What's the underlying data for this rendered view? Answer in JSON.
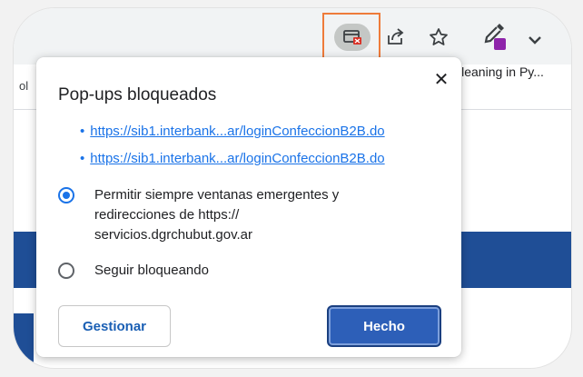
{
  "browser": {
    "bookmark_left_fragment": "ol",
    "bookmark_right": "Cleaning in Py...",
    "toolbar_icons": [
      "popup-blocked-icon",
      "share-icon",
      "star-icon",
      "eyedropper-extension-icon",
      "puzzle-icon"
    ],
    "highlight_color": "#ee7b3a",
    "page_banner_color": "#1f4e96"
  },
  "dialog": {
    "title": "Pop-ups bloqueados",
    "close_glyph": "✕",
    "links": [
      {
        "bullet": "•",
        "text": "https://sib1.interbank...ar/loginConfeccionB2B.do"
      },
      {
        "bullet": "•",
        "text": "https://sib1.interbank...ar/loginConfeccionB2B.do"
      }
    ],
    "options": [
      {
        "label": "Permitir siempre ventanas emergentes y redirecciones de https:// servicios.dgrchubut.gov.ar",
        "checked": true
      },
      {
        "label": "Seguir bloqueando",
        "checked": false
      }
    ],
    "manage_label": "Gestionar",
    "done_label": "Hecho",
    "accent_color": "#1a73e8"
  }
}
